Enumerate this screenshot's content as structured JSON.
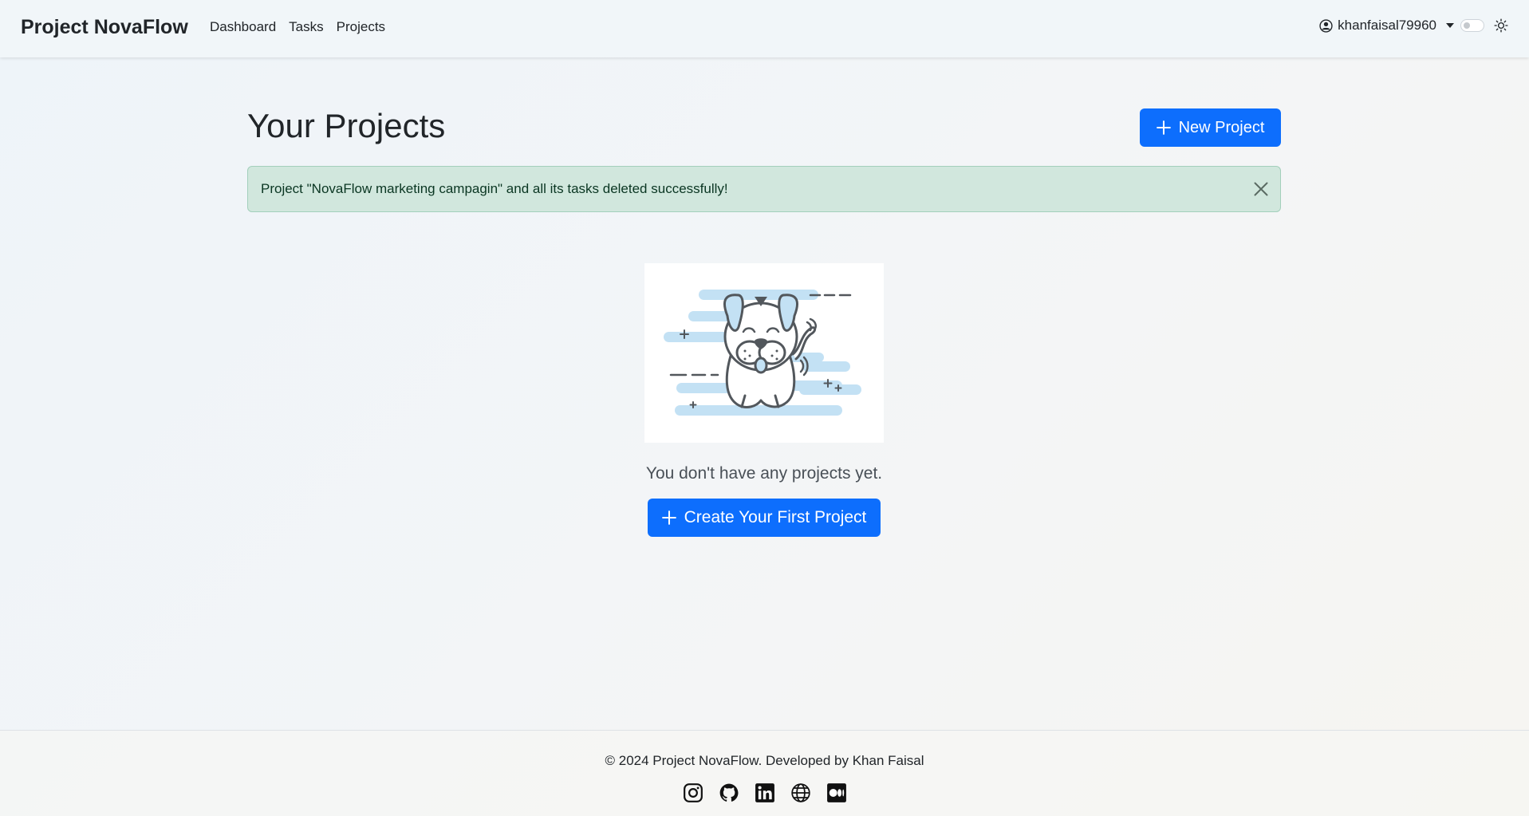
{
  "navbar": {
    "brand": "Project NovaFlow",
    "links": [
      "Dashboard",
      "Tasks",
      "Projects"
    ],
    "username": "khanfaisal79960",
    "user_icon": "person-circle-icon",
    "theme_icon": "sun-icon"
  },
  "main": {
    "title": "Your Projects",
    "new_project_label": "New Project",
    "alert_message": "Project \"NovaFlow marketing campagin\" and all its tasks deleted successfully!",
    "empty_message": "You don't have any projects yet.",
    "create_first_label": "Create Your First Project"
  },
  "footer": {
    "copyright": "© 2024 Project NovaFlow. Developed by Khan Faisal",
    "social_icons": [
      "instagram-icon",
      "github-icon",
      "linkedin-icon",
      "globe-icon",
      "medium-icon"
    ]
  },
  "colors": {
    "primary": "#0d6efd",
    "alert_bg": "#d1e7dd",
    "alert_text": "#0a3622",
    "illustration_blue": "#c3e1f4",
    "illustration_stroke": "#52575c"
  }
}
